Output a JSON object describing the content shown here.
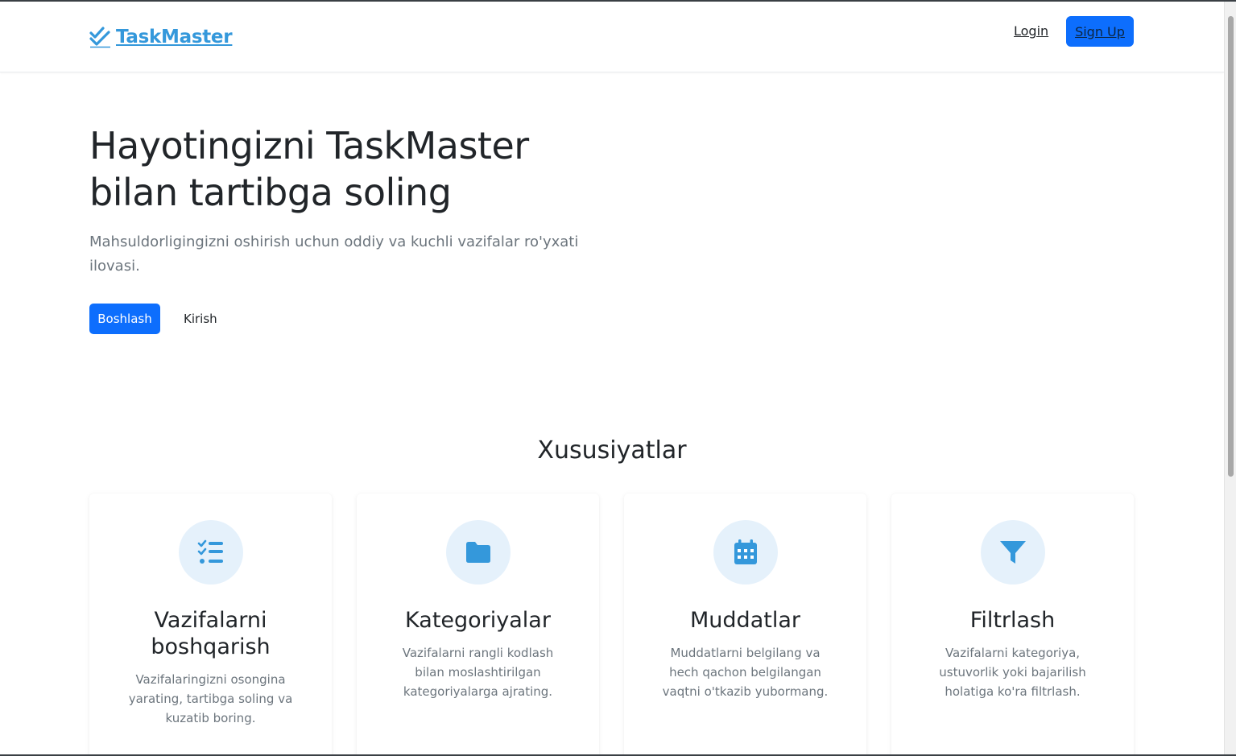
{
  "navbar": {
    "brand": "TaskMaster",
    "login": "Login",
    "signup": "Sign Up"
  },
  "hero": {
    "title": "Hayotingizni TaskMaster bilan tartibga soling",
    "subtitle": "Mahsuldorligingizni oshirish uchun oddiy va kuchli vazifalar ro'yxati ilovasi.",
    "primary_button": "Boshlash",
    "secondary_button": "Kirish"
  },
  "features": {
    "title": "Xususiyatlar",
    "items": [
      {
        "icon": "list-check-icon",
        "title": "Vazifalarni boshqarish",
        "description": "Vazifalaringizni osongina yarating, tartibga soling va kuzatib boring."
      },
      {
        "icon": "folder-icon",
        "title": "Kategoriyalar",
        "description": "Vazifalarni rangli kodlash bilan moslashtirilgan kategoriyalarga ajrating."
      },
      {
        "icon": "calendar-icon",
        "title": "Muddatlar",
        "description": "Muddatlarni belgilang va hech qachon belgilangan vaqtni o'tkazib yubormang."
      },
      {
        "icon": "filter-icon",
        "title": "Filtrlash",
        "description": "Vazifalarni kategoriya, ustuvorlik yoki bajarilish holatiga ko'ra filtrlash."
      }
    ]
  },
  "colors": {
    "accent": "#3498db",
    "primary": "#0d6efd",
    "icon_bg": "#e5f1fb"
  }
}
